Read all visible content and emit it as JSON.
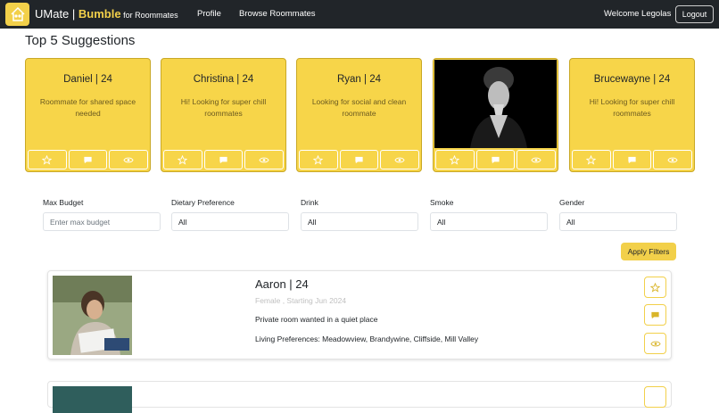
{
  "nav": {
    "brand_prefix": "UMate | ",
    "brand_bold": "Bumble",
    "brand_suffix": " for Roommates",
    "links": [
      "Profile",
      "Browse Roommates"
    ],
    "welcome": "Welcome Legolas",
    "logout_label": "Logout"
  },
  "suggestions": {
    "title": "Top 5 Suggestions",
    "cards": [
      {
        "name": "Daniel | 24",
        "desc": "Roommate for shared space needed"
      },
      {
        "name": "Christina | 24",
        "desc": "Hi! Looking for super chill roommates"
      },
      {
        "name": "Ryan | 24",
        "desc": "Looking for social and clean roommate"
      },
      {
        "name": "",
        "desc": ""
      },
      {
        "name": "Brucewayne | 24",
        "desc": "Hi! Looking for super chill roommates"
      }
    ]
  },
  "filters": {
    "max_budget": {
      "label": "Max Budget",
      "placeholder": "Enter max budget"
    },
    "dietary": {
      "label": "Dietary Preference",
      "value": "All"
    },
    "drink": {
      "label": "Drink",
      "value": "All"
    },
    "smoke": {
      "label": "Smoke",
      "value": "All"
    },
    "gender": {
      "label": "Gender",
      "value": "All"
    },
    "apply_label": "Apply Filters"
  },
  "listings": [
    {
      "name": "Aaron | 24",
      "meta": "Female , Starting Jun 2024",
      "desc": "Private room wanted in a quiet place",
      "prefs": "Living Preferences: Meadowview, Brandywine, Cliffside, Mill Valley"
    }
  ],
  "colors": {
    "accent": "#f2d04a",
    "navbar": "#212529",
    "card": "#f7d549"
  },
  "icons": [
    "home-logo-icon",
    "star-icon",
    "comment-icon",
    "eye-icon"
  ]
}
